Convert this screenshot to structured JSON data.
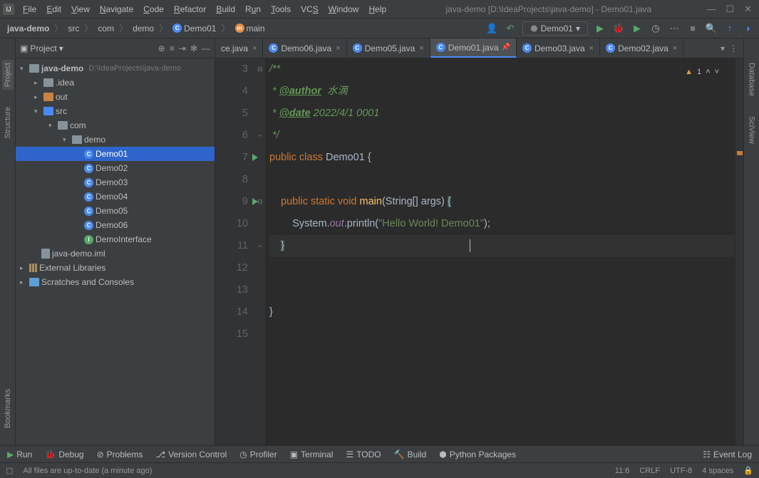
{
  "window": {
    "title": "java-demo [D:\\IdeaProjects\\java-demo] - Demo01.java"
  },
  "menu": [
    "File",
    "Edit",
    "View",
    "Navigate",
    "Code",
    "Refactor",
    "Build",
    "Run",
    "Tools",
    "VCS",
    "Window",
    "Help"
  ],
  "breadcrumb": {
    "project": "java-demo",
    "src": "src",
    "pkg1": "com",
    "pkg2": "demo",
    "cls": "Demo01",
    "method": "main"
  },
  "runconfig": "Demo01",
  "sidebar": {
    "title": "Project",
    "tree": {
      "root": "java-demo",
      "rootpath": "D:\\IdeaProjects\\java-demo",
      "idea": ".idea",
      "out": "out",
      "src": "src",
      "com": "com",
      "demo": "demo",
      "d1": "Demo01",
      "d2": "Demo02",
      "d3": "Demo03",
      "d4": "Demo04",
      "d5": "Demo05",
      "d6": "Demo06",
      "di": "DemoInterface",
      "iml": "java-demo.iml",
      "ext": "External Libraries",
      "scratch": "Scratches and Consoles"
    }
  },
  "tabs": {
    "t0": "ce.java",
    "t1": "Demo06.java",
    "t2": "Demo05.java",
    "t3": "Demo01.java",
    "t4": "Demo03.java",
    "t5": "Demo02.java"
  },
  "code": {
    "l3": "/**",
    "l4a": " * ",
    "l4b": "@author",
    "l4c": "  水滴",
    "l5a": " * ",
    "l5b": "@date",
    "l5c": " 2022/4/1 0001",
    "l6": " */",
    "l7a": "public class ",
    "l7b": "Demo01 ",
    "l7c": "{",
    "l9a": "    public static void ",
    "l9b": "main",
    "l9c": "(String[] args) ",
    "l9d": "{",
    "l10a": "        System.",
    "l10b": "out",
    "l10c": ".println(",
    "l10d": "\"Hello World! Demo01\"",
    "l10e": ");",
    "l11": "    }",
    "l14": "}"
  },
  "gutter": {
    "n3": "3",
    "n4": "4",
    "n5": "5",
    "n6": "6",
    "n7": "7",
    "n8": "8",
    "n9": "9",
    "n10": "10",
    "n11": "11",
    "n12": "12",
    "n13": "13",
    "n14": "14",
    "n15": "15"
  },
  "edstatus": {
    "warn": "1"
  },
  "leftTabs": {
    "project": "Project",
    "structure": "Structure",
    "bookmarks": "Bookmarks"
  },
  "rightTabs": {
    "database": "Database",
    "sciview": "SciView"
  },
  "bottom": {
    "run": "Run",
    "debug": "Debug",
    "problems": "Problems",
    "vcs": "Version Control",
    "profiler": "Profiler",
    "terminal": "Terminal",
    "todo": "TODO",
    "build": "Build",
    "python": "Python Packages",
    "eventlog": "Event Log"
  },
  "status": {
    "msg": "All files are up-to-date (a minute ago)",
    "pos": "11:6",
    "eol": "CRLF",
    "enc": "UTF-8",
    "indent": "4 spaces"
  }
}
